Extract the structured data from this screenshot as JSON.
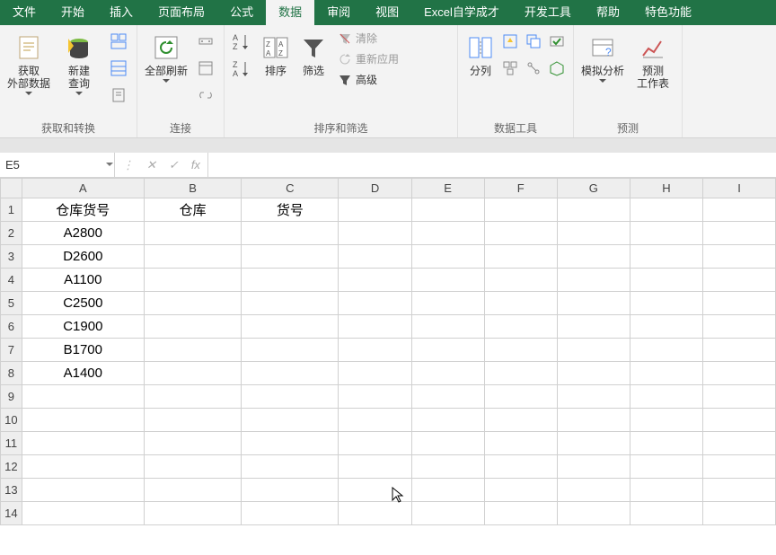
{
  "tabs": [
    "文件",
    "开始",
    "插入",
    "页面布局",
    "公式",
    "数据",
    "审阅",
    "视图",
    "Excel自学成才",
    "开发工具",
    "帮助",
    "特色功能"
  ],
  "active_tab_index": 5,
  "ribbon": {
    "groups": [
      {
        "label": "获取和转换",
        "big": [
          {
            "name": "get-ext-data",
            "label": "获取\n外部数据"
          },
          {
            "name": "new-query",
            "label": "新建\n查询"
          }
        ],
        "mini": [
          "tables-icon",
          "recent-icon",
          "conn-icon"
        ]
      },
      {
        "label": "连接",
        "big": [
          {
            "name": "refresh-all",
            "label": "全部刷新"
          }
        ],
        "mini": [
          "props-icon",
          "links-icon",
          "edit-links-icon"
        ]
      },
      {
        "label": "排序和筛选",
        "col1": [
          "sort-asc",
          "sort-desc"
        ],
        "col2": [
          "za-block"
        ],
        "big": [
          {
            "name": "sort",
            "label": "排序"
          },
          {
            "name": "filter",
            "label": "筛选"
          }
        ],
        "right": [
          {
            "name": "clear",
            "label": "清除",
            "disabled": true
          },
          {
            "name": "reapply",
            "label": "重新应用",
            "disabled": true
          },
          {
            "name": "advanced",
            "label": "高级",
            "disabled": false
          }
        ]
      },
      {
        "label": "数据工具",
        "big": [
          {
            "name": "text-to-cols",
            "label": "分列"
          }
        ],
        "grid": [
          "flash-fill",
          "dup",
          "validate",
          "consolidate",
          "goal",
          "relation"
        ]
      },
      {
        "label": "预测",
        "big": [
          {
            "name": "what-if",
            "label": "模拟分析"
          },
          {
            "name": "forecast",
            "label": "预测\n工作表"
          }
        ]
      }
    ]
  },
  "namebox": "E5",
  "formula": "",
  "columns": [
    "A",
    "B",
    "C",
    "D",
    "E",
    "F",
    "G",
    "H",
    "I"
  ],
  "rows": [
    1,
    2,
    3,
    4,
    5,
    6,
    7,
    8,
    9,
    10,
    11,
    12,
    13,
    14
  ],
  "cells": {
    "A1": "仓库货号",
    "B1": "仓库",
    "C1": "货号",
    "A2": "A2800",
    "A3": "D2600",
    "A4": "A1100",
    "A5": "C2500",
    "A6": "C1900",
    "A7": "B1700",
    "A8": "A1400"
  }
}
